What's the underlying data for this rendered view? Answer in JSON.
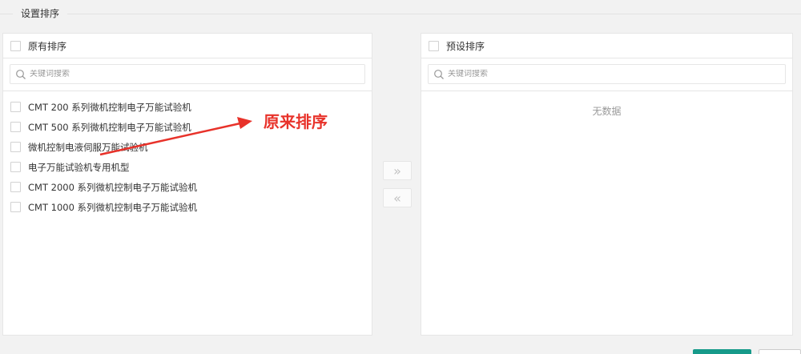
{
  "fieldset": {
    "legend": "设置排序"
  },
  "left_panel": {
    "title": "原有排序",
    "search_placeholder": "关键词搜索",
    "items": [
      {
        "label": "CMT 200 系列微机控制电子万能试验机"
      },
      {
        "label": "CMT 500 系列微机控制电子万能试验机"
      },
      {
        "label": "微机控制电液伺服万能试验机"
      },
      {
        "label": "电子万能试验机专用机型"
      },
      {
        "label": "CMT 2000 系列微机控制电子万能试验机"
      },
      {
        "label": "CMT 1000 系列微机控制电子万能试验机"
      }
    ]
  },
  "right_panel": {
    "title": "预设排序",
    "search_placeholder": "关键词搜索",
    "empty_text": "无数据"
  },
  "transfer": {
    "to_right_symbol": "»",
    "to_left_symbol": "«"
  },
  "annotation": {
    "text": "原来排序",
    "color": "#e8322a"
  },
  "colors": {
    "accent": "#169a8a",
    "border": "#e6e6e6",
    "background": "#f2f2f2"
  }
}
